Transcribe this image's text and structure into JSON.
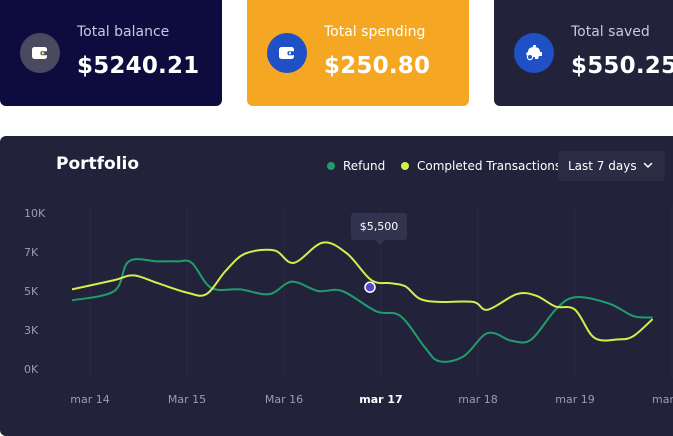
{
  "cards": {
    "balance": {
      "label": "Total balance",
      "value": "$5240.21",
      "icon": "wallet-icon"
    },
    "spending": {
      "label": "Total spending",
      "value": "$250.80",
      "icon": "wallet-icon"
    },
    "saved": {
      "label": "Total saved",
      "value": "$550.25",
      "icon": "piggy-bank-icon"
    }
  },
  "portfolio": {
    "title": "Portfolio",
    "range_select": "Last 7 days",
    "tooltip": "$5,500"
  },
  "colors": {
    "refund": "#1f9d6b",
    "completed": "#d7ee4a",
    "marker": "#5549c8"
  },
  "chart_data": {
    "type": "line",
    "x": [
      "mar 14",
      "Mar 15",
      "Mar 16",
      "mar 17",
      "mar 18",
      "mar 19",
      "mar"
    ],
    "active_x": "mar 17",
    "y_ticks": [
      "10K",
      "7K",
      "5K",
      "3K",
      "0K"
    ],
    "series": [
      {
        "name": "Refund",
        "points": [
          [
            0,
            4.4
          ],
          [
            0.25,
            5.0
          ],
          [
            0.4,
            6.9
          ],
          [
            0.7,
            6.9
          ],
          [
            0.9,
            6.9
          ],
          [
            1.05,
            6.8
          ],
          [
            1.25,
            5.2
          ],
          [
            1.55,
            5.1
          ],
          [
            1.85,
            4.8
          ],
          [
            2.08,
            5.6
          ],
          [
            2.35,
            5.0
          ],
          [
            2.6,
            5.0
          ],
          [
            2.95,
            3.7
          ],
          [
            3.2,
            3.4
          ],
          [
            3.45,
            1.4
          ],
          [
            3.6,
            0.5
          ],
          [
            3.85,
            0.8
          ],
          [
            4.1,
            2.3
          ],
          [
            4.35,
            1.8
          ],
          [
            4.55,
            1.9
          ],
          [
            4.8,
            3.8
          ],
          [
            5.0,
            4.6
          ],
          [
            5.35,
            4.2
          ],
          [
            5.6,
            3.4
          ],
          [
            5.8,
            3.3
          ]
        ]
      },
      {
        "name": "Completed Transactions",
        "points": [
          [
            0,
            5.1
          ],
          [
            0.25,
            5.7
          ],
          [
            0.45,
            6.0
          ],
          [
            0.7,
            5.5
          ],
          [
            1.0,
            4.9
          ],
          [
            1.2,
            4.8
          ],
          [
            1.4,
            6.3
          ],
          [
            1.6,
            7.4
          ],
          [
            1.9,
            7.6
          ],
          [
            2.1,
            6.8
          ],
          [
            2.4,
            8.1
          ],
          [
            2.65,
            7.4
          ],
          [
            2.9,
            5.7
          ],
          [
            3.1,
            5.5
          ],
          [
            3.25,
            5.3
          ],
          [
            3.4,
            4.5
          ],
          [
            3.6,
            4.3
          ],
          [
            3.95,
            4.3
          ],
          [
            4.1,
            3.8
          ],
          [
            4.4,
            4.8
          ],
          [
            4.6,
            4.7
          ],
          [
            4.8,
            4.0
          ],
          [
            5.0,
            3.8
          ],
          [
            5.2,
            2.0
          ],
          [
            5.45,
            1.9
          ],
          [
            5.6,
            2.1
          ],
          [
            5.8,
            3.2
          ]
        ]
      }
    ],
    "highlight": {
      "x": 3,
      "y": 5.5,
      "label": "$5,500"
    }
  }
}
